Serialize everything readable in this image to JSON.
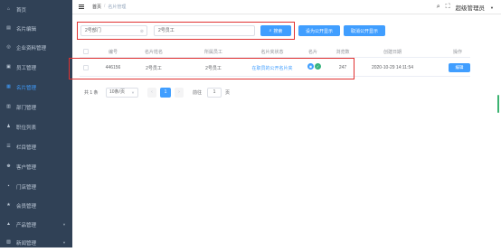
{
  "sidebar": {
    "items": [
      {
        "label": "首页",
        "icon": "home-icon",
        "glyph": "⌂"
      },
      {
        "label": "名片编辑",
        "icon": "edit-card-icon",
        "glyph": "▤"
      },
      {
        "label": "企业资料管理",
        "icon": "enterprise-icon",
        "glyph": "◎"
      },
      {
        "label": "员工管理",
        "icon": "staff-icon",
        "glyph": "▣"
      },
      {
        "label": "名片管理",
        "icon": "card-icon",
        "glyph": "▦"
      },
      {
        "label": "部门管理",
        "icon": "department-icon",
        "glyph": "▥"
      },
      {
        "label": "职位列表",
        "icon": "position-icon",
        "glyph": "♟"
      },
      {
        "label": "栏目管理",
        "icon": "column-icon",
        "glyph": "☰"
      },
      {
        "label": "客户管理",
        "icon": "customer-icon",
        "glyph": "♚"
      },
      {
        "label": "门店管理",
        "icon": "store-icon",
        "glyph": "▪"
      },
      {
        "label": "会员管理",
        "icon": "member-icon",
        "glyph": "★"
      },
      {
        "label": "产品管理",
        "icon": "product-icon",
        "glyph": "▲"
      },
      {
        "label": "新闻管理",
        "icon": "news-icon",
        "glyph": "▧"
      }
    ],
    "active_index": 4
  },
  "topbar": {
    "breadcrumb_home": "首页",
    "breadcrumb_sep": "/",
    "breadcrumb_current": "名片管理",
    "user_name": "超级管理员"
  },
  "filters": {
    "department_value": "2号部门",
    "staff_value": "2号员工",
    "search_label": "搜索",
    "set_public_label": "设为公开显示",
    "cancel_public_label": "取消公开显示",
    "clear_glyph": "⊗"
  },
  "table": {
    "headers": [
      "编号",
      "名片姓名",
      "所属员工",
      "名片夹状态",
      "名片",
      "浏览数",
      "创建日期",
      "操作"
    ],
    "rows": [
      {
        "id": "446156",
        "card_name": "2号员工",
        "staff": "2号员工",
        "status": "在职员的公开名片夹",
        "views": "247",
        "created": "2020-10-29 14:11:54",
        "action": "编辑"
      }
    ]
  },
  "pager": {
    "total": "共 1 条",
    "page_size": "10条/页",
    "prev": "‹",
    "current_page": "1",
    "next": "›",
    "goto_label": "前往",
    "goto_value": "1",
    "page_unit": "页"
  },
  "colors": {
    "sidebar_bg": "#304156",
    "accent": "#409eff",
    "highlight_border": "#e03131"
  }
}
